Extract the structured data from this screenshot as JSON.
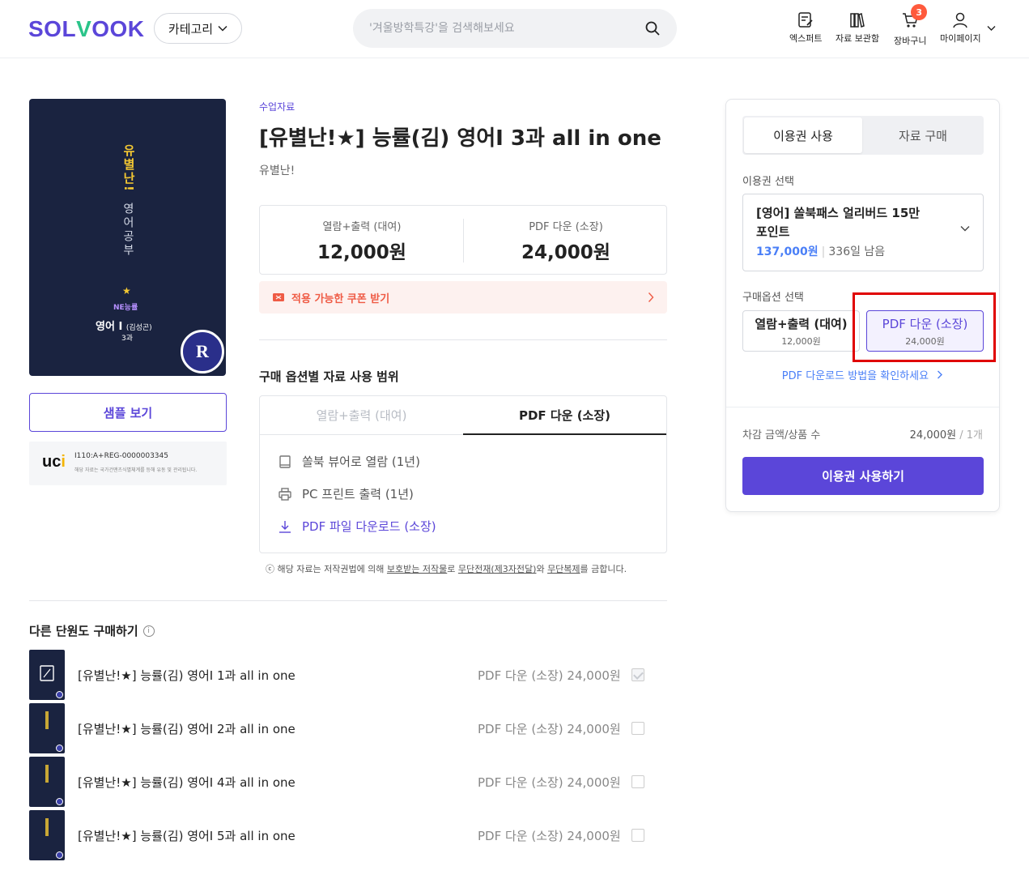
{
  "header": {
    "logo": {
      "part1": "SOL",
      "part2": "V",
      "part3": "OOK"
    },
    "category_button": "카테고리",
    "search_placeholder": "'겨울방학특강'을 검색해보세요",
    "nav": [
      {
        "label": "엑스퍼트",
        "icon": "expert-icon"
      },
      {
        "label": "자료 보관함",
        "icon": "library-icon"
      },
      {
        "label": "장바구니",
        "icon": "cart-icon",
        "badge": "3"
      },
      {
        "label": "마이페이지",
        "icon": "user-icon"
      }
    ]
  },
  "cover": {
    "title_vertical": "유별난!",
    "subtitle_vertical": "영어공부",
    "star": "★",
    "publisher": "NE능률",
    "subject": "영어 I",
    "author": "(김성곤)",
    "chapter": "3과",
    "seal_letter": "R"
  },
  "left": {
    "sample_button": "샘플 보기",
    "uci_logo_a": "uc",
    "uci_logo_b": "i",
    "uci_code": "I110:A+REG-0000003345",
    "uci_note": "해당 자료는 국가건맨츠식별체계를 등해 유동 및 관리됩니다."
  },
  "product": {
    "category": "수업자료",
    "title": "[유별난!★] 능률(김) 영어I 3과 all in one",
    "author": "유별난!",
    "prices": [
      {
        "label": "열람+출력 (대여)",
        "value": "12,000원"
      },
      {
        "label": "PDF 다운 (소장)",
        "value": "24,000원"
      }
    ],
    "coupon": "적용 가능한 쿠폰 받기"
  },
  "scope": {
    "title": "구매 옵션별 자료 사용 범위",
    "tabs": [
      "열람+출력 (대여)",
      "PDF 다운 (소장)"
    ],
    "items": [
      {
        "label": "쏠북 뷰어로 열람 (1년)",
        "icon": "viewer-icon"
      },
      {
        "label": "PC 프린트 출력 (1년)",
        "icon": "printer-icon"
      },
      {
        "label": "PDF 파일 다운로드 (소장)",
        "icon": "download-icon"
      }
    ],
    "copyright_a": "ⓒ 해당 자료는 저작권법에 의해 ",
    "copyright_b": "보호받는 저작물",
    "copyright_c": "로 ",
    "copyright_d": "무단전재(제3자전달)",
    "copyright_e": "와 ",
    "copyright_f": "무단복제",
    "copyright_g": "를 금합니다."
  },
  "other": {
    "title": "다른 단원도 구매하기",
    "rows": [
      {
        "name": "[유별난!★] 능률(김) 영어I 1과 all in one",
        "price": "PDF 다운 (소장) 24,000원",
        "checked": true
      },
      {
        "name": "[유별난!★] 능률(김) 영어I 2과 all in one",
        "price": "PDF 다운 (소장) 24,000원",
        "checked": false
      },
      {
        "name": "[유별난!★] 능률(김) 영어I 4과 all in one",
        "price": "PDF 다운 (소장) 24,000원",
        "checked": false
      },
      {
        "name": "[유별난!★] 능률(김) 영어I 5과 all in one",
        "price": "PDF 다운 (소장) 24,000원",
        "checked": false
      }
    ]
  },
  "panel": {
    "tabs": [
      "이용권 사용",
      "자료 구매"
    ],
    "pass_label": "이용권 선택",
    "pass_name": "[영어] 쏠북패스 얼리버드 15만 포인트",
    "pass_points": "137,000원",
    "pass_remaining": "336일 남음",
    "option_label": "구매옵션 선택",
    "options": [
      {
        "name": "열람+출력 (대여)",
        "price": "12,000원"
      },
      {
        "name": "PDF 다운 (소장)",
        "price": "24,000원"
      }
    ],
    "pdf_help": "PDF 다운로드 방법을 확인하세요",
    "sum_label": "차감 금액/상품 수",
    "sum_value": "24,000원",
    "sum_count": " / 1개",
    "use_button": "이용권 사용하기"
  },
  "colors": {
    "brand": "#5b46d9",
    "accent_green": "#2bc48a",
    "coupon": "#ef5b45",
    "link_blue": "#4a7ff7",
    "highlight": "#e00000"
  }
}
